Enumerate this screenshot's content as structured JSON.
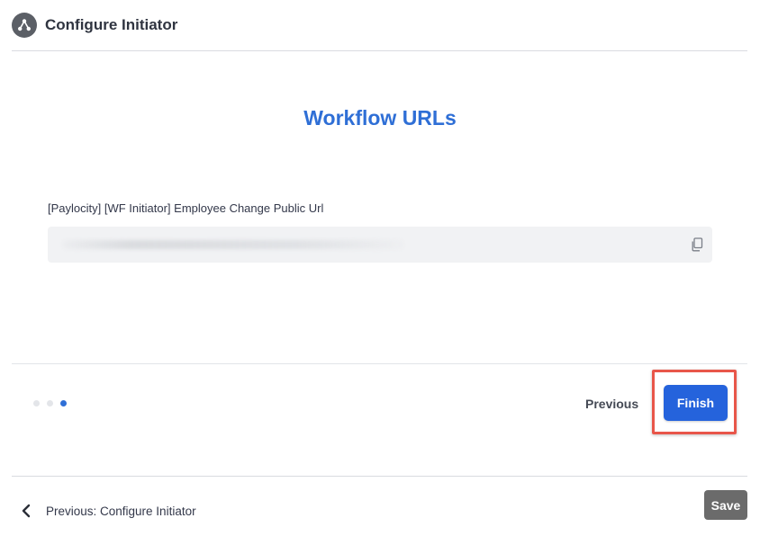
{
  "header": {
    "icon": "workflow-icon",
    "title": "Configure Initiator"
  },
  "main": {
    "title": "Workflow URLs",
    "url_label": "[Paylocity] [WF Initiator] Employee Change Public Url",
    "url_value_visible": false,
    "copy_icon": "copy-icon"
  },
  "stepper": {
    "total_steps": 3,
    "current_step": 3,
    "previous_label": "Previous",
    "finish_label": "Finish"
  },
  "footer": {
    "back_label": "Previous: Configure Initiator",
    "save_label": "Save"
  },
  "colors": {
    "accent": "#2f6fd6",
    "finish_button": "#2563dc",
    "highlight_border": "#e8564a",
    "save_button": "#6b6b6b"
  }
}
